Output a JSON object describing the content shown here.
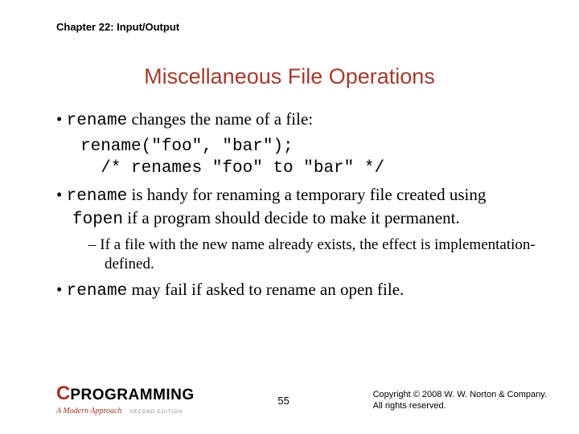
{
  "chapter": "Chapter 22: Input/Output",
  "title": "Miscellaneous File Operations",
  "bullets": {
    "b1_code1": "rename",
    "b1_rest": " changes the name of a file:",
    "code_line1": "rename(\"foo\", \"bar\");",
    "code_line2": "  /* renames \"foo\" to \"bar\" */",
    "b2_code1": "rename",
    "b2_mid": " is handy for renaming a temporary file created using ",
    "b2_code2": "fopen",
    "b2_rest": " if a program should decide to make it permanent.",
    "b2_sub1": "If a file with the new name already exists, the effect is implementation-defined.",
    "b3_code1": "rename",
    "b3_rest": " may fail if asked to rename an open file."
  },
  "logo": {
    "c": "C",
    "prog": "PROGRAMMING",
    "sub": "A Modern Approach",
    "edition": "SECOND EDITION"
  },
  "page": "55",
  "copyright_l1": "Copyright © 2008 W. W. Norton & Company.",
  "copyright_l2": "All rights reserved."
}
